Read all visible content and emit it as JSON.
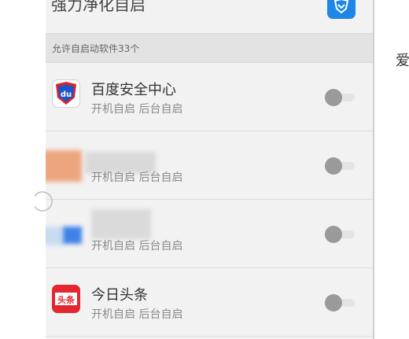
{
  "header": {
    "title": "强力净化自启"
  },
  "section": {
    "label": "允许自启动软件33个"
  },
  "apps": [
    {
      "name": "百度安全中心",
      "sub": "开机自启 后台自启",
      "enabled": false,
      "icon": "baidu-security-icon"
    },
    {
      "name": "",
      "sub": "开机自启 后台自启",
      "enabled": false,
      "icon": "blurred-app-icon"
    },
    {
      "name": "",
      "sub": "开机自启 后台自启",
      "enabled": false,
      "icon": "blurred-app-icon"
    },
    {
      "name": "今日头条",
      "sub": "开机自启 后台自启",
      "enabled": false,
      "icon": "toutiao-icon"
    }
  ],
  "edge": {
    "char": "爱"
  },
  "colors": {
    "accent": "#1e86e6",
    "baidu_red": "#d9232a",
    "baidu_blue": "#1b55c9",
    "toutiao_red": "#e3262f"
  }
}
